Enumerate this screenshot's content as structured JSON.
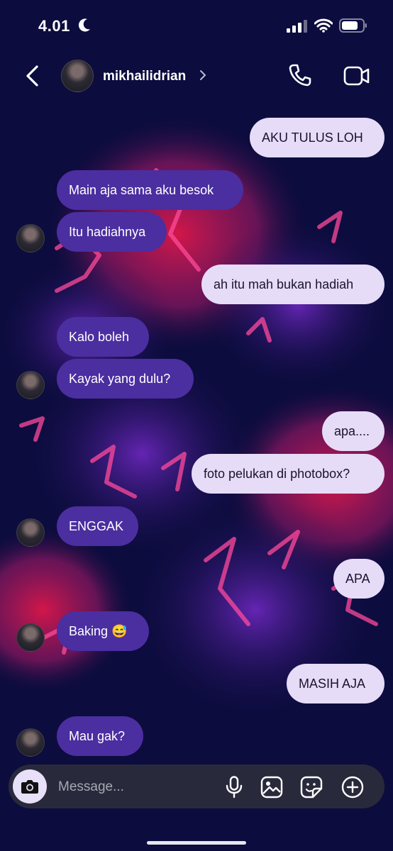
{
  "status_bar": {
    "time": "4.01"
  },
  "header": {
    "username": "mikhailidrian"
  },
  "messages": [
    {
      "side": "sent",
      "text": "AKU TULUS LOH"
    },
    {
      "side": "recv",
      "text": "Main aja sama aku besok"
    },
    {
      "side": "recv",
      "text": "Itu hadiahnya"
    },
    {
      "side": "sent",
      "text": "ah itu mah bukan hadiah"
    },
    {
      "side": "recv",
      "text": "Kalo boleh"
    },
    {
      "side": "recv",
      "text": "Kayak yang dulu?"
    },
    {
      "side": "sent",
      "text": "apa...."
    },
    {
      "side": "sent",
      "text": "foto pelukan di photobox?"
    },
    {
      "side": "recv",
      "text": "ENGGAK"
    },
    {
      "side": "sent",
      "text": "APA"
    },
    {
      "side": "recv",
      "text": "Baking 😅"
    },
    {
      "side": "sent",
      "text": "MASIH AJA"
    },
    {
      "side": "recv",
      "text": "Mau gak?"
    }
  ],
  "composer": {
    "placeholder": "Message..."
  },
  "colors": {
    "sent_bubble": "#e6dcf7",
    "recv_bubble": "#4b2ea0",
    "background": "#0c0c3e"
  },
  "icons": [
    "back-icon",
    "chevron-right-icon",
    "phone-icon",
    "video-icon",
    "camera-icon",
    "microphone-icon",
    "gallery-icon",
    "sticker-icon",
    "plus-icon"
  ]
}
